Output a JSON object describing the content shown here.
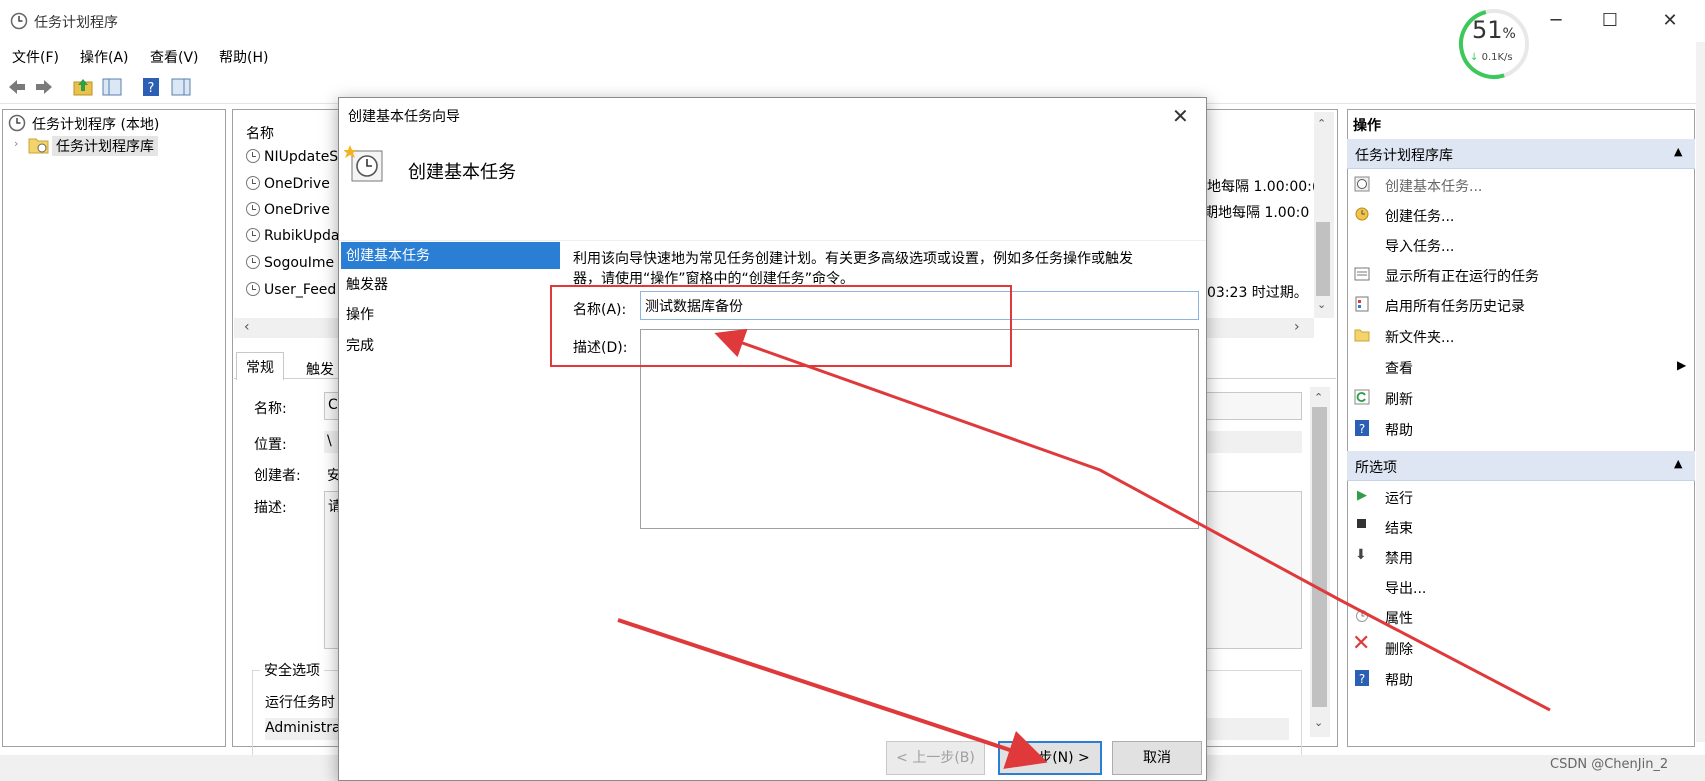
{
  "window": {
    "title": "任务计划程序"
  },
  "menu": [
    "文件(F)",
    "操作(A)",
    "查看(V)",
    "帮助(H)"
  ],
  "network_widget": {
    "percent": "51",
    "percent_unit": "%",
    "speed": "0.1K/s"
  },
  "tree": {
    "root": "任务计划程序 (本地)",
    "child": "任务计划程序库"
  },
  "task_list": {
    "header_name": "名称",
    "rows": [
      {
        "name": "NIUpdateS",
        "trigger": ""
      },
      {
        "name": "OneDrive",
        "trigger": "地每隔 1.00:00:("
      },
      {
        "name": "OneDrive",
        "trigger": "期地每隔 1.00:0"
      },
      {
        "name": "RubikUpda",
        "trigger": ""
      },
      {
        "name": "SogouIme",
        "trigger": ""
      },
      {
        "name": "User_Feed",
        "trigger": "03:23 时过期。"
      }
    ]
  },
  "details": {
    "tabs": [
      "常规",
      "触发"
    ],
    "labels": {
      "name": "名称:",
      "location": "位置:",
      "author": "创建者:",
      "description": "描述:"
    },
    "values": {
      "name": "C",
      "location": "\\",
      "author": "安",
      "description": "请"
    },
    "security_title": "安全选项",
    "run_label": "运行任务时",
    "admin": "Administra"
  },
  "actions": {
    "header": "操作",
    "section1": "任务计划程序库",
    "items1": [
      "创建基本任务...",
      "创建任务...",
      "导入任务...",
      "显示所有正在运行的任务",
      "启用所有任务历史记录",
      "新文件夹...",
      "查看",
      "刷新",
      "帮助"
    ],
    "section2": "所选项",
    "items2": [
      "运行",
      "结束",
      "禁用",
      "导出...",
      "属性",
      "删除",
      "帮助"
    ]
  },
  "dialog": {
    "title": "创建基本任务向导",
    "header": "创建基本任务",
    "nav": [
      "创建基本任务",
      "触发器",
      "操作",
      "完成"
    ],
    "intro_line1": "利用该向导快速地为常见任务创建计划。有关更多高级选项或设置，例如多任务操作或触发",
    "intro_line2": "器，请使用“操作”窗格中的“创建任务”命令。",
    "name_label": "名称(A):",
    "name_value": "测试数据库备份",
    "desc_label": "描述(D):",
    "desc_value": "",
    "btn_back": "< 上一步(B)",
    "btn_next": "下一步(N) >",
    "btn_cancel": "取消"
  },
  "watermark": "CSDN @ChenJin_2",
  "colors": {
    "accent": "#2a7ed3",
    "annotation": "#e0393b",
    "gauge": "#3cc85a"
  }
}
